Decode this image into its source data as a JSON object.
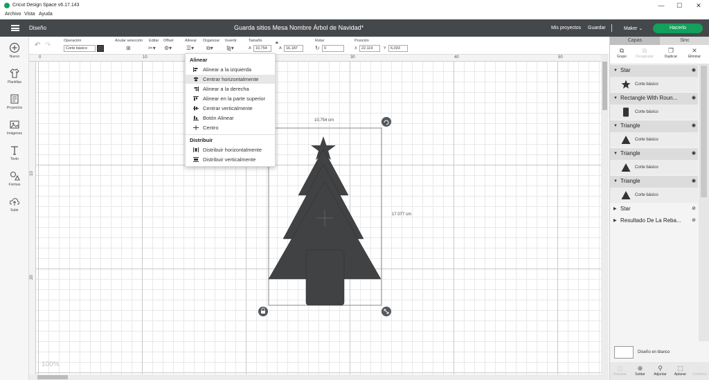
{
  "window": {
    "title": "Cricut Design Space  v6.17.143",
    "minimize": "—",
    "maximize": "☐",
    "close": "✕"
  },
  "menu": [
    "Archivo",
    "Vista",
    "Ayuda"
  ],
  "header": {
    "section": "Diseño",
    "doc_title": "Guarda sitios Mesa Nombre Árbol de Navidad*",
    "my_projects": "Mis proyectos",
    "save": "Guardar",
    "separator": "|",
    "machine": "Maker",
    "make_it": "Hacerlo",
    "accent_color": "#12a05c"
  },
  "toolbar": {
    "operation_label": "Operación",
    "operation_value": "Corte básico",
    "deselect_label": "Anular selección",
    "edit_label": "Editar",
    "offset_label": "Offset",
    "align_label": "Alinear",
    "arrange_label": "Organizar",
    "flip_label": "Invertir",
    "size_label": "Tamaño",
    "width_prefix": "A",
    "width_value": "10,754",
    "height_prefix": "A",
    "height_value": "16,187",
    "rotate_label": "Rotar",
    "rotate_value": "0",
    "position_label": "Posición",
    "x_prefix": "X",
    "x_value": "22,119",
    "y_prefix": "Y",
    "y_value": "6,033",
    "swatch_color": "#404244"
  },
  "sidebar": [
    {
      "label": "Nuevo",
      "icon": "plus-circle-icon"
    },
    {
      "label": "Plantillas",
      "icon": "shirt-icon"
    },
    {
      "label": "Proyectos",
      "icon": "projects-icon"
    },
    {
      "label": "Imágenes",
      "icon": "image-icon"
    },
    {
      "label": "Texto",
      "icon": "text-icon"
    },
    {
      "label": "Formas",
      "icon": "shapes-icon"
    },
    {
      "label": "Subir",
      "icon": "upload-icon"
    }
  ],
  "rulers": {
    "top": [
      "0",
      "10",
      "20",
      "30",
      "40",
      "50"
    ],
    "left": [
      "10",
      "20"
    ]
  },
  "canvas": {
    "zoom": "100%",
    "width_dim": "10.754 cm",
    "height_dim": "17.077 cm",
    "shape_color": "#404244"
  },
  "align_menu": {
    "align_heading": "Alinear",
    "align_items": [
      {
        "label": "Alinear a la izquierda",
        "active": false
      },
      {
        "label": "Centrar horizontalmente",
        "active": true
      },
      {
        "label": "Alinear a la derecha",
        "active": false
      },
      {
        "label": "Alinear en la parte superior",
        "active": false
      },
      {
        "label": "Centrar verticalmente",
        "active": false
      },
      {
        "label": "Botón Alinear",
        "active": false
      },
      {
        "label": "Centro",
        "active": false
      }
    ],
    "distribute_heading": "Distribuir",
    "distribute_items": [
      {
        "label": "Distribuir horizontalmente"
      },
      {
        "label": "Distribuir verticalmente"
      }
    ]
  },
  "panel": {
    "tabs": [
      "Capas",
      "Sinc"
    ],
    "actions": [
      {
        "label": "Grupo",
        "disabled": false
      },
      {
        "label": "Desagrupar",
        "disabled": true
      },
      {
        "label": "Duplicar",
        "disabled": false
      },
      {
        "label": "Eliminar",
        "disabled": false
      }
    ],
    "layers": [
      {
        "name": "Star",
        "sub": "Corte básico",
        "shape": "star"
      },
      {
        "name": "Rectangle With Roun...",
        "sub": "Corte básico",
        "shape": "rect"
      },
      {
        "name": "Triangle",
        "sub": "Corte básico",
        "shape": "triangle"
      },
      {
        "name": "Triangle",
        "sub": "Corte básico",
        "shape": "triangle"
      },
      {
        "name": "Triangle",
        "sub": "Corte básico",
        "shape": "triangle"
      }
    ],
    "hidden_layers": [
      "Star",
      "Resultado De La Reba..."
    ],
    "blank_canvas": "Diseño en blanco",
    "bottom_actions": [
      {
        "label": "Rebanar",
        "disabled": true
      },
      {
        "label": "Soldar",
        "disabled": false
      },
      {
        "label": "Adjuntar",
        "disabled": false
      },
      {
        "label": "Aplanar",
        "disabled": false
      },
      {
        "label": "Contorno",
        "disabled": true
      }
    ]
  }
}
